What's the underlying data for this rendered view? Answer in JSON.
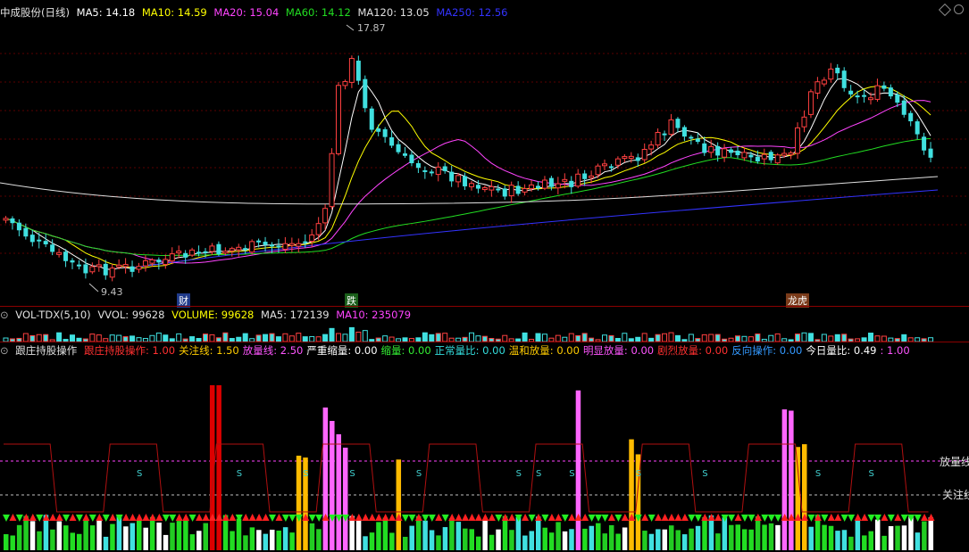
{
  "price_header": {
    "title": "中成股份(日线)",
    "ma5": "MA5: 14.18",
    "ma10": "MA10: 14.59",
    "ma20": "MA20: 15.04",
    "ma60": "MA60: 14.12",
    "ma120": "MA120: 13.05",
    "ma250": "MA250: 12.56"
  },
  "price_labels": {
    "high": "17.87",
    "low": "9.43"
  },
  "event_tags": [
    "财",
    "跌",
    "龙虎"
  ],
  "vol_header": {
    "title": "VOL-TDX(5,10)",
    "vvol": "VVOL: 99628",
    "volume": "VOLUME: 99628",
    "ma5": "MA5: 172139",
    "ma10": "MA10: 235079"
  },
  "ind_header": {
    "title": "跟庄持股操作",
    "items": [
      {
        "label": "跟庄持股操作: 1.00",
        "color": "#ff3030"
      },
      {
        "label": "关注线: 1.50",
        "color": "#ffcc00"
      },
      {
        "label": "放量线: 2.50",
        "color": "#ff55ff"
      },
      {
        "label": "严重缩量: 0.00",
        "color": "#ffffff"
      },
      {
        "label": "缩量: 0.00",
        "color": "#33ee33"
      },
      {
        "label": "正常量比: 0.00",
        "color": "#33dddd"
      },
      {
        "label": "温和放量: 0.00",
        "color": "#ffcc00"
      },
      {
        "label": "明显放量: 0.00",
        "color": "#ff55ff"
      },
      {
        "label": "剧烈放量: 0.00",
        "color": "#ff3030"
      },
      {
        "label": "反向操作: 0.00",
        "color": "#3399ff"
      },
      {
        "label": "今日量比: 0.49",
        "color": "#ffffff"
      },
      {
        "label": ": 1.00",
        "color": "#ff55ff"
      }
    ]
  },
  "ind_right_labels": {
    "fangliang": "放量线",
    "guanzhu": "关注线"
  },
  "s_marker": "S",
  "colors": {
    "up": "#ff4040",
    "down": "#40e0e0",
    "ma5": "#ffffff",
    "ma10": "#ffff00",
    "ma20": "#ff44ff",
    "ma60": "#22dd22",
    "ma120": "#e0e0e0",
    "ma250": "#3333ff",
    "separator": "#8b0000"
  }
}
